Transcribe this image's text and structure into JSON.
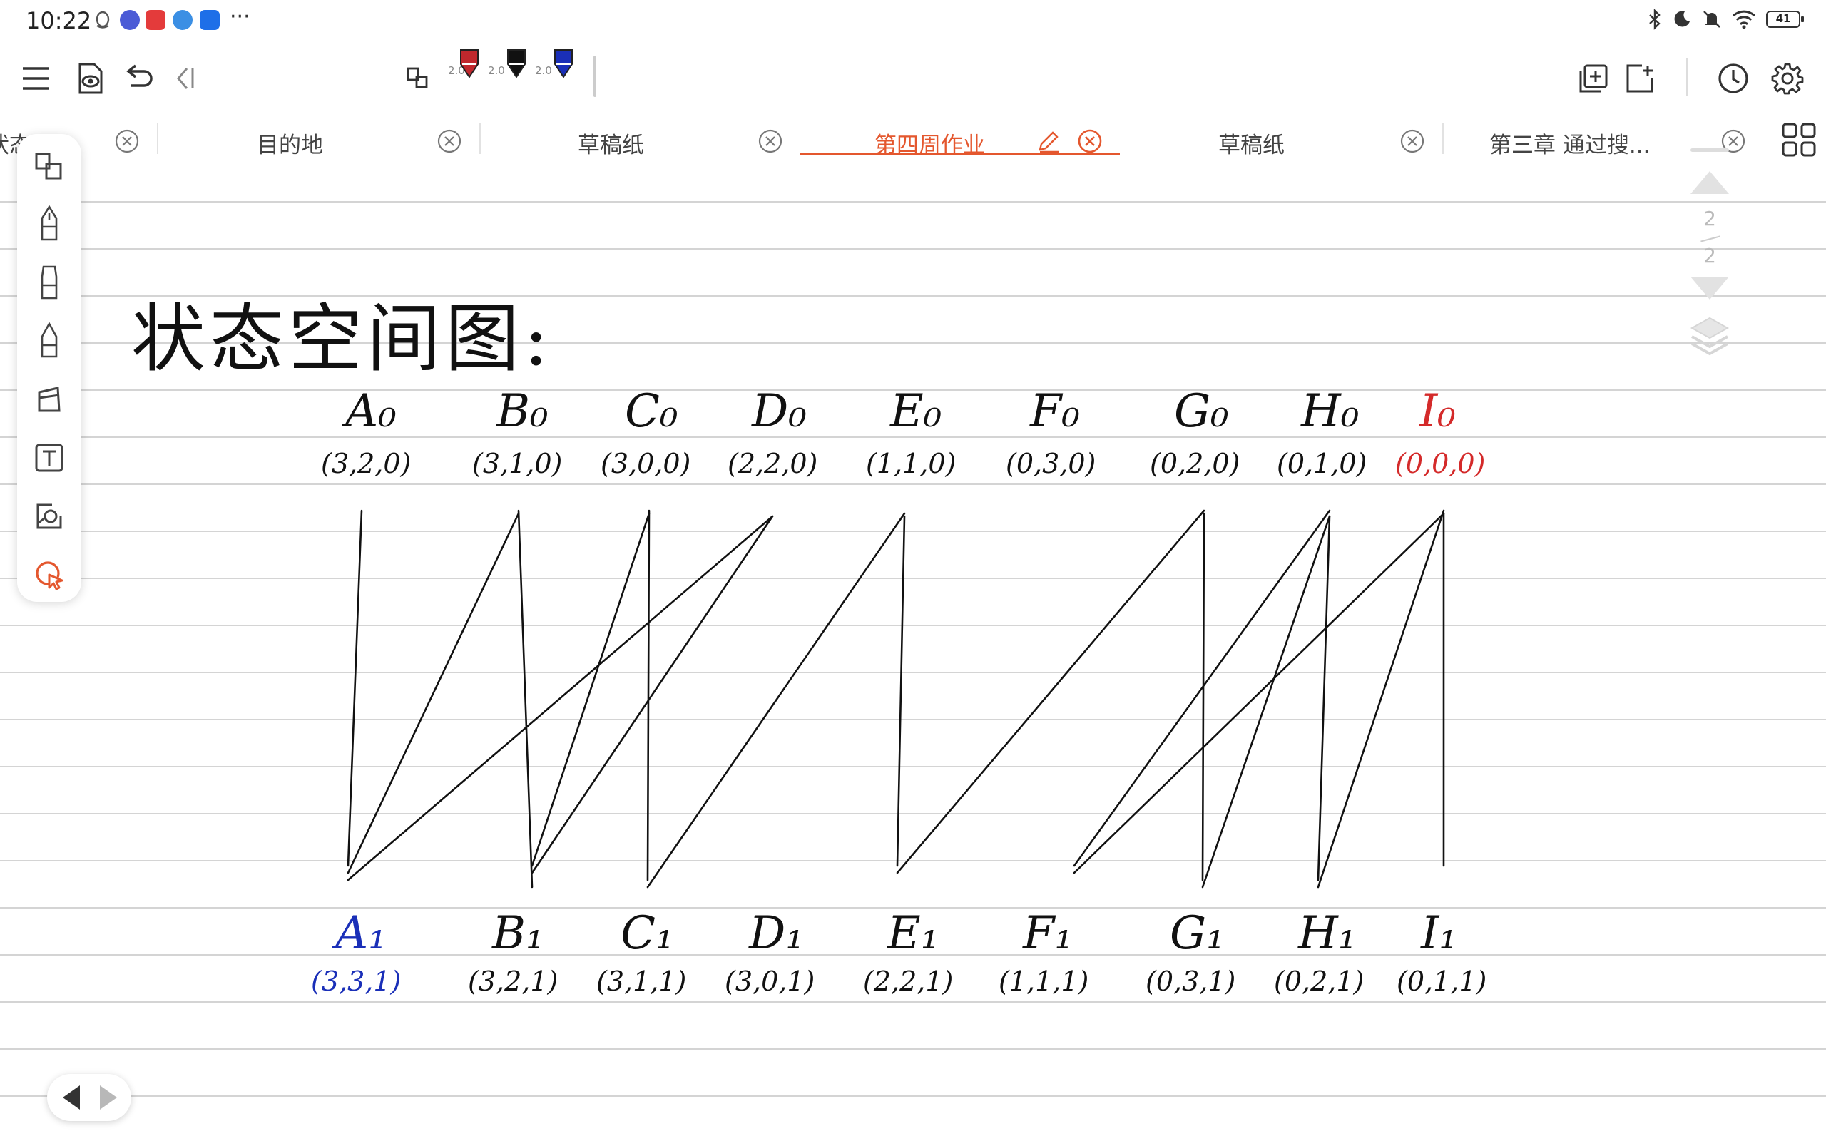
{
  "status_bar": {
    "time": "10:22",
    "more": "···",
    "battery": "41"
  },
  "toolbar": {
    "pen_sizes": [
      "2.0",
      "2.0",
      "2.0"
    ],
    "pen_colors": [
      "#c0282d",
      "#111111",
      "#1a2fb8"
    ]
  },
  "tabs": [
    {
      "label": "状态",
      "active": false
    },
    {
      "label": "目的地",
      "active": false
    },
    {
      "label": "草稿纸",
      "active": false
    },
    {
      "label": "第四周作业",
      "active": true
    },
    {
      "label": "草稿纸",
      "active": false
    },
    {
      "label": "第三章 通过搜...",
      "active": false
    }
  ],
  "accent_color": "#e4572e",
  "page_nav": {
    "current": "2",
    "total": "2"
  },
  "note": {
    "title": "状态空间图:",
    "top_nodes": [
      {
        "label": "A₀",
        "coord": "(3,2,0)",
        "color": "black"
      },
      {
        "label": "B₀",
        "coord": "(3,1,0)",
        "color": "black"
      },
      {
        "label": "C₀",
        "coord": "(3,0,0)",
        "color": "black"
      },
      {
        "label": "D₀",
        "coord": "(2,2,0)",
        "color": "black"
      },
      {
        "label": "E₀",
        "coord": "(1,1,0)",
        "color": "black"
      },
      {
        "label": "F₀",
        "coord": "(0,3,0)",
        "color": "black"
      },
      {
        "label": "G₀",
        "coord": "(0,2,0)",
        "color": "black"
      },
      {
        "label": "H₀",
        "coord": "(0,1,0)",
        "color": "black"
      },
      {
        "label": "I₀",
        "coord": "(0,0,0)",
        "color": "red"
      }
    ],
    "bottom_nodes": [
      {
        "label": "A₁",
        "coord": "(3,3,1)",
        "color": "blue"
      },
      {
        "label": "B₁",
        "coord": "(3,2,1)",
        "color": "black"
      },
      {
        "label": "C₁",
        "coord": "(3,1,1)",
        "color": "black"
      },
      {
        "label": "D₁",
        "coord": "(3,0,1)",
        "color": "black"
      },
      {
        "label": "E₁",
        "coord": "(2,2,1)",
        "color": "black"
      },
      {
        "label": "F₁",
        "coord": "(1,1,1)",
        "color": "black"
      },
      {
        "label": "G₁",
        "coord": "(0,3,1)",
        "color": "black"
      },
      {
        "label": "H₁",
        "coord": "(0,2,1)",
        "color": "black"
      },
      {
        "label": "I₁",
        "coord": "(0,1,1)",
        "color": "black"
      }
    ],
    "edges": [
      [
        "A₀",
        "A₁"
      ],
      [
        "B₀",
        "A₁"
      ],
      [
        "D₀",
        "A₁"
      ],
      [
        "B₀",
        "B₁"
      ],
      [
        "C₀",
        "B₁"
      ],
      [
        "D₀",
        "B₁"
      ],
      [
        "C₀",
        "C₁"
      ],
      [
        "E₀",
        "C₁"
      ],
      [
        "E₀",
        "E₁"
      ],
      [
        "G₀",
        "E₁"
      ],
      [
        "G₀",
        "G₁"
      ],
      [
        "H₀",
        "G₁"
      ],
      [
        "H₀",
        "F₁"
      ],
      [
        "I₀",
        "F₁"
      ],
      [
        "H₀",
        "H₁"
      ],
      [
        "I₀",
        "H₁"
      ],
      [
        "I₀",
        "I₁"
      ]
    ]
  }
}
